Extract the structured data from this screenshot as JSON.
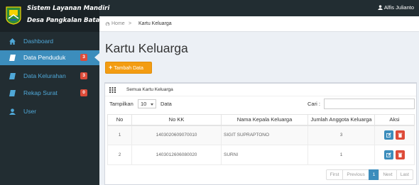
{
  "brand": {
    "line1": "Sistem Layanan Mandiri",
    "line2": "Desa Pangkalan Batang"
  },
  "user": {
    "name": "Alfis Julianto",
    "icon": "user-icon"
  },
  "colors": {
    "sidebar": "#222d32",
    "active": "#3c8dbc",
    "badge": "#dd4b39",
    "add_button": "#f39c12"
  },
  "sidebar": {
    "items": [
      {
        "label": "Dashboard",
        "icon": "home-icon",
        "badge": null,
        "active": false
      },
      {
        "label": "Data Penduduk",
        "icon": "book-icon",
        "badge": "3",
        "active": true
      },
      {
        "label": "Data Kelurahan",
        "icon": "book-icon",
        "badge": "3",
        "active": false
      },
      {
        "label": "Rekap Surat",
        "icon": "book-icon",
        "badge": "0",
        "active": false
      },
      {
        "label": "User",
        "icon": "user-icon",
        "badge": null,
        "active": false
      }
    ]
  },
  "breadcrumb": {
    "home": "Home",
    "separator": ">",
    "current": "Kartu Keluarga"
  },
  "page": {
    "title": "Kartu Keluarga",
    "add_button": "Tambah Data"
  },
  "box": {
    "title": "Semua Kartu Keluarga"
  },
  "table_controls": {
    "show_label": "Tampilkan",
    "length_value": "10",
    "length_suffix": "Data",
    "search_label": "Cari :",
    "search_value": ""
  },
  "table": {
    "columns": [
      "No",
      "No KK",
      "Nama Kepala Keluarga",
      "Jumlah Anggota Keluarga",
      "Aksi"
    ],
    "rows": [
      {
        "no": "1",
        "no_kk": "1403020609070010",
        "nama": "SIGIT SUPRAPTONO",
        "jumlah": "3"
      },
      {
        "no": "2",
        "no_kk": "1403012606080020",
        "nama": "SURNI",
        "jumlah": "1"
      }
    ]
  },
  "pagination": {
    "first": "First",
    "previous": "Previous",
    "current": "1",
    "next": "Next",
    "last": "Last"
  }
}
